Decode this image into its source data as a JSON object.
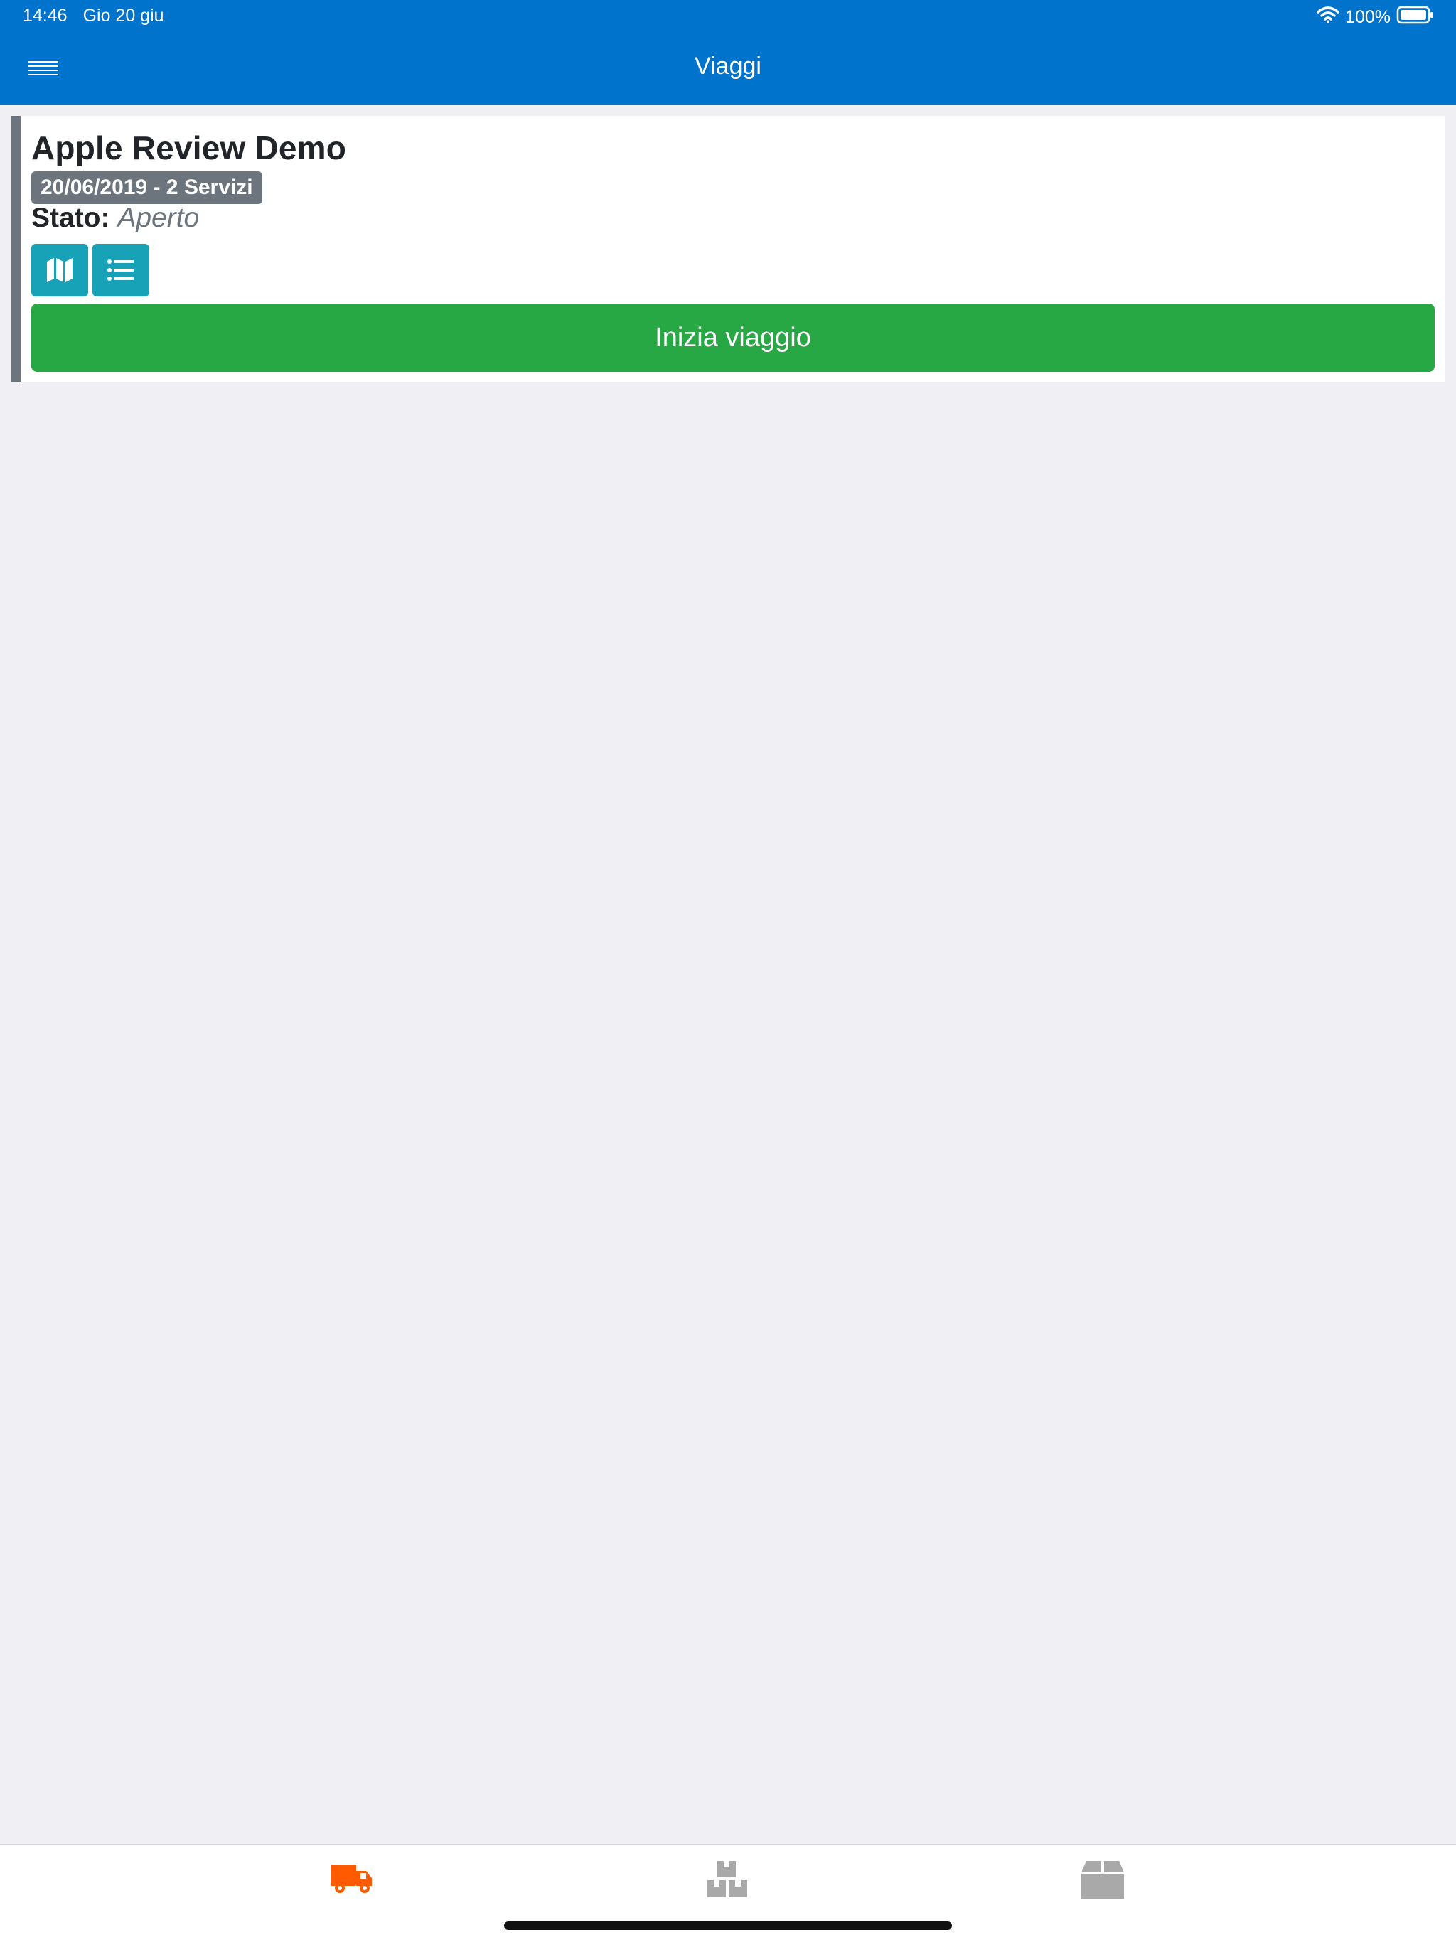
{
  "status_bar": {
    "time": "14:46",
    "date": "Gio 20 giu",
    "battery": "100%",
    "wifi_icon": "wifi-icon",
    "battery_icon": "battery-icon"
  },
  "header": {
    "title": "Viaggi",
    "menu_icon": "menu-icon",
    "background": "#0073cc"
  },
  "trip": {
    "title": "Apple Review Demo",
    "badge": "20/06/2019 - 2 Servizi",
    "status_label": "Stato:",
    "status_value": "Aperto",
    "map_icon": "map-icon",
    "list_icon": "list-icon",
    "start_button": "Inizia viaggio"
  },
  "tabs": [
    {
      "icon": "truck-icon",
      "active": true
    },
    {
      "icon": "boxes-icon",
      "active": false
    },
    {
      "icon": "box-icon",
      "active": false
    }
  ],
  "colors": {
    "accent": "#0073cc",
    "success": "#28a745",
    "info": "#17a2b8",
    "muted": "#6c757d",
    "tab_active": "#ff5a00",
    "tab_inactive": "#a9a9a9"
  }
}
